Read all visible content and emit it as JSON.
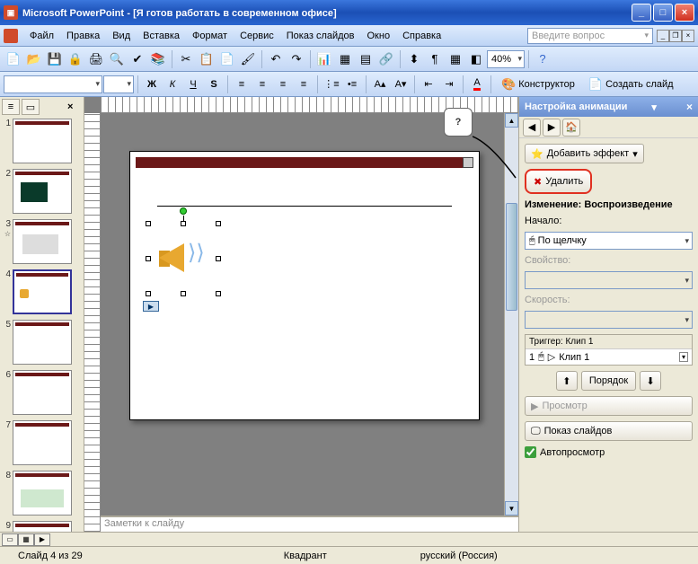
{
  "app": {
    "name": "Microsoft PowerPoint",
    "document": "[Я готов работать в современном офисе]"
  },
  "menubar": {
    "items": [
      "Файл",
      "Правка",
      "Вид",
      "Вставка",
      "Формат",
      "Сервис",
      "Показ слайдов",
      "Окно",
      "Справка"
    ],
    "ask_placeholder": "Введите вопрос"
  },
  "toolbar1": {
    "zoom": "40%"
  },
  "toolbar2": {
    "designer_label": "Конструктор",
    "new_slide_label": "Создать слайд"
  },
  "thumbnails": {
    "count": 9,
    "active": 4
  },
  "slide": {
    "notes_placeholder": "Заметки к слайду"
  },
  "taskpane": {
    "title": "Настройка анимации",
    "add_effect": "Добавить эффект",
    "delete": "Удалить",
    "change_section": "Изменение: Воспроизведение",
    "start_label": "Начало:",
    "start_value": "По щелчку",
    "property_label": "Свойство:",
    "speed_label": "Скорость:",
    "trigger_label": "Триггер: Клип 1",
    "anim_item": {
      "index": "1",
      "name": "Клип 1"
    },
    "reorder": "Порядок",
    "preview": "Просмотр",
    "slideshow": "Показ слайдов",
    "autopreview": "Автопросмотр"
  },
  "statusbar": {
    "slide_pos": "Слайд 4 из 29",
    "template": "Квадрант",
    "language": "русский (Россия)"
  },
  "callout": {
    "text": "?"
  }
}
